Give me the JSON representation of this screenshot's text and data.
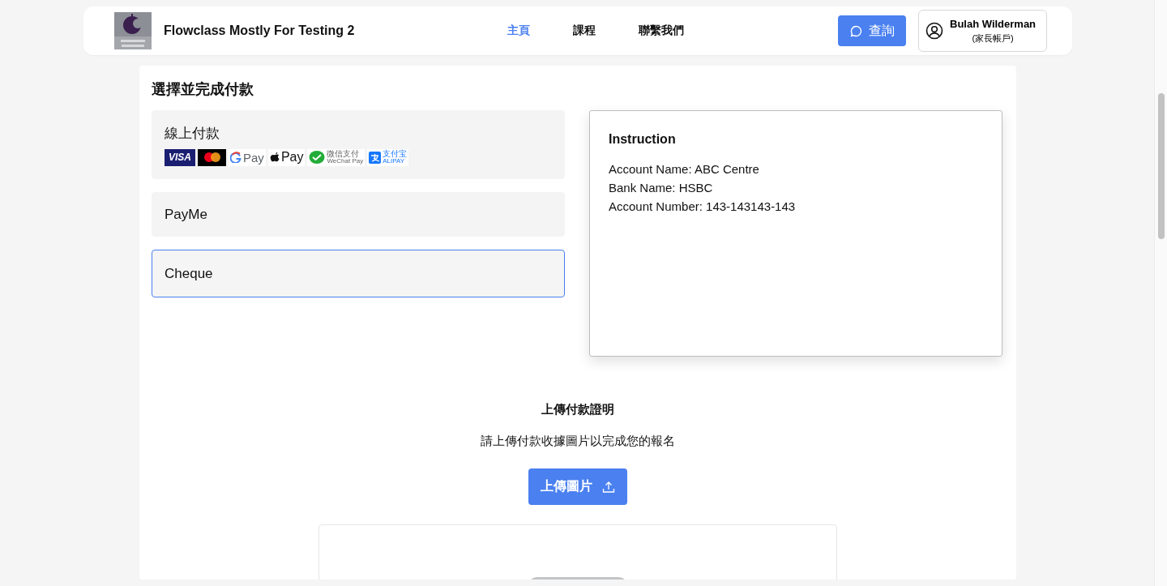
{
  "header": {
    "site_title": "Flowclass Mostly For Testing 2",
    "nav": [
      {
        "label": "主頁",
        "selected": true
      },
      {
        "label": "課程",
        "selected": false
      },
      {
        "label": "聯繫我們",
        "selected": false
      }
    ],
    "enquiry_button": "查詢",
    "account": {
      "name": "Bulah Wilderman",
      "role": "(家長帳戶)"
    }
  },
  "payment": {
    "title": "選擇並完成付款",
    "methods": [
      {
        "label": "線上付款",
        "selected": false,
        "logos": [
          {
            "kind": "visa",
            "label": "VISA"
          },
          {
            "kind": "mastercard"
          },
          {
            "kind": "gpay",
            "label": "Pay"
          },
          {
            "kind": "applepay",
            "label": "Pay"
          },
          {
            "kind": "wechat",
            "label": "微信支付",
            "sub": "WeChat Pay"
          },
          {
            "kind": "alipay",
            "label": "支付宝",
            "sub": "ALIPAY"
          }
        ]
      },
      {
        "label": "PayMe",
        "selected": false
      },
      {
        "label": "Cheque",
        "selected": true
      }
    ],
    "instruction": {
      "title": "Instruction",
      "lines": [
        "Account Name: ABC Centre",
        "Bank Name: HSBC",
        "Account Number: 143-143143-143"
      ]
    }
  },
  "upload": {
    "title": "上傳付款證明",
    "hint": "請上傳付款收據圖片以完成您的報名",
    "button": "上傳圖片"
  }
}
